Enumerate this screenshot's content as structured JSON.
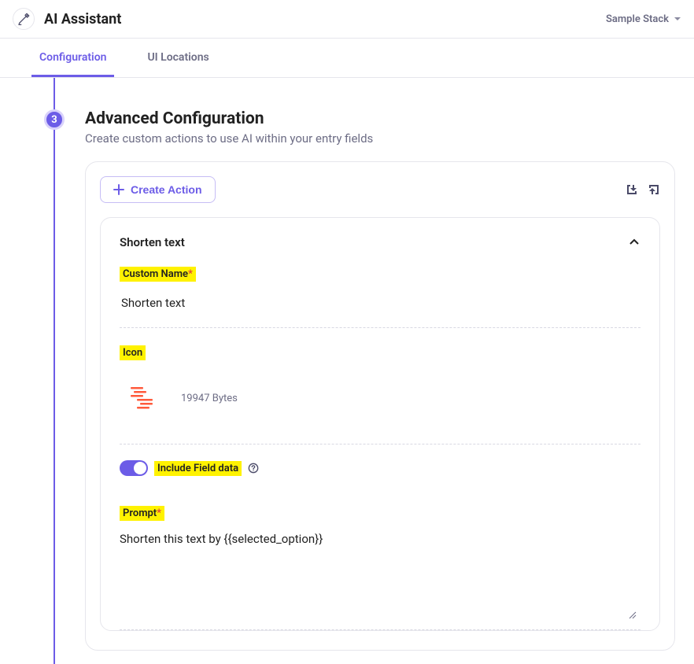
{
  "header": {
    "title": "AI Assistant",
    "stack_label": "Sample Stack"
  },
  "tabs": [
    {
      "label": "Configuration",
      "active": true
    },
    {
      "label": "UI Locations",
      "active": false
    }
  ],
  "step": {
    "number": "3",
    "title": "Advanced Configuration",
    "description": "Create custom actions to use AI within your entry fields"
  },
  "toolbar": {
    "create_action_label": "Create Action"
  },
  "action": {
    "title": "Shorten text",
    "custom_name_label": "Custom Name",
    "custom_name_required": "*",
    "custom_name_value": "Shorten text",
    "icon_label": "Icon",
    "icon_bytes": "19947 Bytes",
    "include_field_label": "Include Field data",
    "prompt_label": "Prompt",
    "prompt_required": "*",
    "prompt_value": "Shorten this text by {{selected_option}}"
  }
}
